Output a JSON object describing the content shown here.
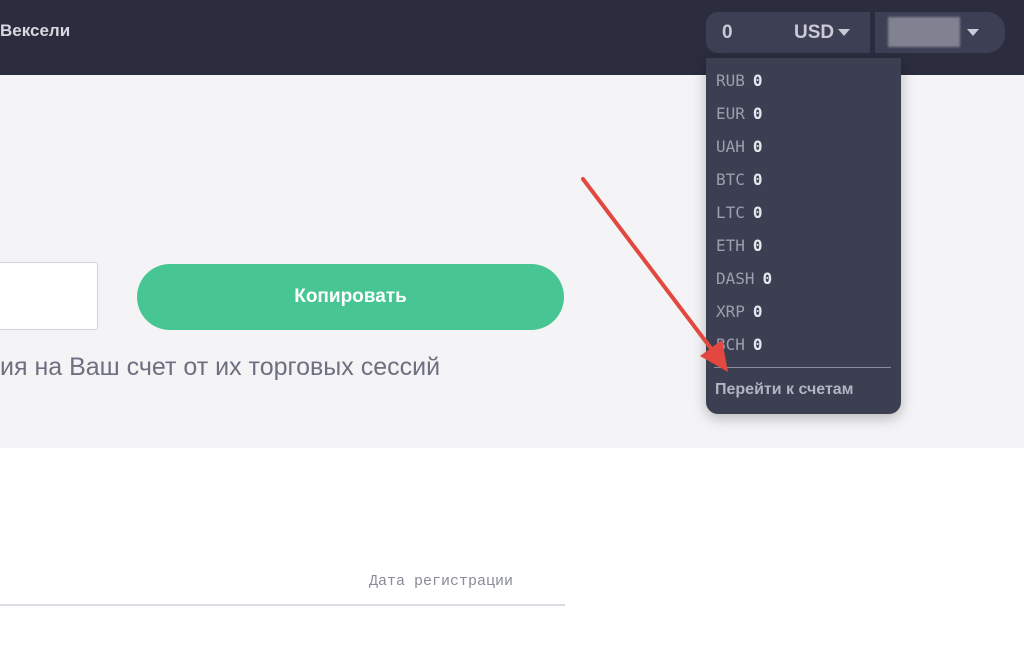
{
  "header": {
    "nav_item": "Вексели",
    "balance": "0",
    "currency": "USD"
  },
  "hero": {
    "copy_button": "Копировать",
    "description": "ия на Ваш счет от их торговых сессий"
  },
  "table": {
    "column_registration_date": "Дата регистрации"
  },
  "dropdown": {
    "currencies": [
      {
        "code": "RUB",
        "amount": "0"
      },
      {
        "code": "EUR",
        "amount": "0"
      },
      {
        "code": "UAH",
        "amount": "0"
      },
      {
        "code": "BTC",
        "amount": "0"
      },
      {
        "code": "LTC",
        "amount": "0"
      },
      {
        "code": "ETH",
        "amount": "0"
      },
      {
        "code": "DASH",
        "amount": "0"
      },
      {
        "code": "XRP",
        "amount": "0"
      },
      {
        "code": "BCH",
        "amount": "0"
      }
    ],
    "go_to_accounts": "Перейти к счетам"
  },
  "colors": {
    "topbar": "#2b2d3f",
    "accent_green": "#47c693",
    "dropdown_bg": "#3c3e52",
    "annotation_arrow": "#e2483f"
  },
  "icons": {
    "currency_caret": "chevron-down-icon",
    "user_caret": "chevron-down-icon",
    "annotation": "arrow-annotation"
  }
}
